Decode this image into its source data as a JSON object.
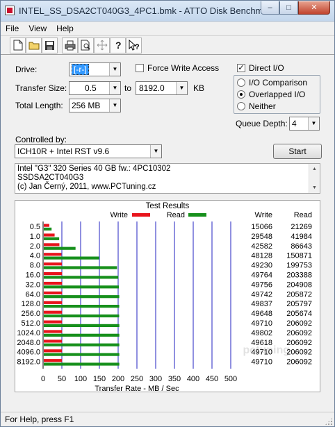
{
  "window": {
    "title": "INTEL_SS_DSA2CT040G3_4PC1.bmk - ATTO Disk Benchmark",
    "minimize_glyph": "–",
    "maximize_glyph": "□",
    "close_glyph": "✕"
  },
  "menu": [
    "File",
    "View",
    "Help"
  ],
  "toolbar": {
    "icons": [
      "new-file-icon",
      "open-folder-icon",
      "save-icon",
      "print-icon",
      "print-preview-icon",
      "move-icon",
      "help-icon",
      "context-help-icon"
    ],
    "glyphs": [
      "🗋",
      "📂",
      "💾",
      "🖨",
      "🔍",
      "✛",
      "?",
      "↗?"
    ]
  },
  "settings": {
    "drive_label": "Drive:",
    "drive_value": "[-r-]",
    "force_write_label": "Force Write Access",
    "force_write_checked": false,
    "direct_io_label": "Direct I/O",
    "direct_io_checked": true,
    "transfer_size_label": "Transfer Size:",
    "transfer_size_from": "0.5",
    "to_label": "to",
    "transfer_size_to": "8192.0",
    "kb_label": "KB",
    "total_length_label": "Total Length:",
    "total_length_value": "256 MB",
    "io_comparison_label": "I/O Comparison",
    "overlapped_io_label": "Overlapped I/O",
    "neither_label": "Neither",
    "selected_io_mode": "Overlapped I/O",
    "queue_depth_label": "Queue Depth:",
    "queue_depth_value": "4",
    "controlled_by_label": "Controlled by:",
    "controlled_by_value": "ICH10R + Intel RST v9.6",
    "start_label": "Start"
  },
  "description": {
    "lines": [
      "Intel \"G3\" 320 Series 40 GB fw.: 4PC10302",
      "SSDSA2CT040G3",
      "(c) Jan Černý, 2011, www.PCTuning.cz"
    ]
  },
  "results": {
    "title": "Test Results",
    "col_write": "Write",
    "col_read": "Read"
  },
  "chart_data": {
    "type": "bar",
    "orientation": "horizontal",
    "categories": [
      "0.5",
      "1.0",
      "2.0",
      "4.0",
      "8.0",
      "16.0",
      "32.0",
      "64.0",
      "128.0",
      "256.0",
      "512.0",
      "1024.0",
      "2048.0",
      "4096.0",
      "8192.0"
    ],
    "series": [
      {
        "name": "Write",
        "color": "#e8141c",
        "values": [
          15066,
          29548,
          42582,
          48128,
          49230,
          49764,
          49756,
          49742,
          49837,
          49648,
          49710,
          49802,
          49618,
          49710,
          49710
        ]
      },
      {
        "name": "Read",
        "color": "#17901c",
        "values": [
          21269,
          41984,
          86643,
          150871,
          199753,
          203388,
          204908,
          205872,
          205797,
          205674,
          206092,
          206092,
          206092,
          206092,
          206092
        ]
      }
    ],
    "value_units": "KB/s",
    "xlabel": "Transfer Rate - MB / Sec",
    "xlim": [
      0,
      500
    ],
    "xticks": [
      "0",
      "50",
      "100",
      "150",
      "200",
      "250",
      "300",
      "350",
      "400",
      "450",
      "500"
    ],
    "grid_color": "#2020c0",
    "legend_position": "top",
    "watermark": "pctuning"
  },
  "status": {
    "text": "For Help, press F1"
  }
}
